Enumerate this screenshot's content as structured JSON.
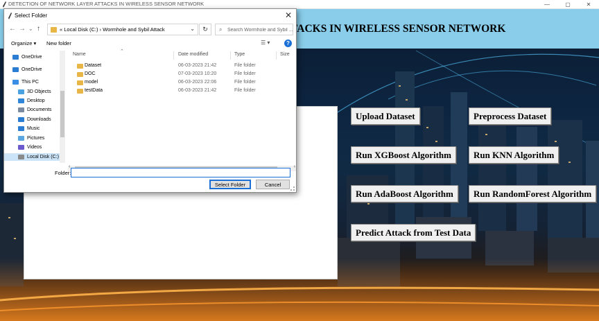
{
  "main_window": {
    "title": "DETECTION OF NETWORK LAYER ATTACKS IN WIRELESS SENSOR NETWORK",
    "controls": {
      "minimize": "—",
      "maximize": "▢",
      "close": "✕"
    }
  },
  "header": {
    "heading": "DETECTION OF NETWORK LAYER ATTACKS IN WIRELESS SENSOR NETWORK"
  },
  "buttons": {
    "upload": "Upload  Dataset",
    "preprocess": "Preprocess Dataset",
    "xgboost": "Run XGBoost Algorithm",
    "knn": "Run KNN Algorithm",
    "adaboost": "Run AdaBoost Algorithm",
    "randomforest": "Run RandomForest Algorithm",
    "predict": "Predict Attack from Test Data"
  },
  "dialog": {
    "title": "Select Folder",
    "close": "✕",
    "address": {
      "prefix": "«",
      "segments": [
        "Local Disk (C:)",
        "Wormhole and Sybil Attack"
      ],
      "separator": "›"
    },
    "search_placeholder": "Search Wormhole and Sybil ...",
    "toolbar": {
      "organize": "Organize ▾",
      "new_folder": "New folder",
      "view": "☰ ▾",
      "help": "?"
    },
    "nav_items": [
      {
        "label": "OneDrive",
        "icon": "cloud-icon",
        "color": "#2b7cd3"
      },
      {
        "label": "OneDrive",
        "icon": "cloud-icon",
        "color": "#2b7cd3"
      },
      {
        "label": "This PC",
        "icon": "computer-icon",
        "color": "#3a8ee6"
      },
      {
        "label": "3D Objects",
        "icon": "cube-icon",
        "color": "#4aa3e0"
      },
      {
        "label": "Desktop",
        "icon": "desktop-icon",
        "color": "#2f86d8"
      },
      {
        "label": "Documents",
        "icon": "document-icon",
        "color": "#7a8aa0"
      },
      {
        "label": "Downloads",
        "icon": "download-icon",
        "color": "#2b7cd3"
      },
      {
        "label": "Music",
        "icon": "music-icon",
        "color": "#2b7cd3"
      },
      {
        "label": "Pictures",
        "icon": "picture-icon",
        "color": "#59a6e0"
      },
      {
        "label": "Videos",
        "icon": "video-icon",
        "color": "#6a5acd"
      },
      {
        "label": "Local Disk (C:)",
        "icon": "disk-icon",
        "color": "#8a8a8a"
      }
    ],
    "columns": [
      "Name",
      "Date modified",
      "Type",
      "Size"
    ],
    "files": [
      {
        "name": "Dataset",
        "date": "06-03-2023 21:42",
        "type": "File folder"
      },
      {
        "name": "DOC",
        "date": "07-03-2023 10:20",
        "type": "File folder"
      },
      {
        "name": "model",
        "date": "06-03-2023 22:06",
        "type": "File folder"
      },
      {
        "name": "testData",
        "date": "06-03-2023 21:42",
        "type": "File folder"
      }
    ],
    "folder_label": "Folder:",
    "folder_value": "",
    "select_button": "Select Folder",
    "cancel_button": "Cancel"
  },
  "colors": {
    "header_bg": "#89cdea",
    "accent": "#1a6fd6",
    "folder_icon": "#e8b547",
    "selection": "#cce4f7"
  }
}
